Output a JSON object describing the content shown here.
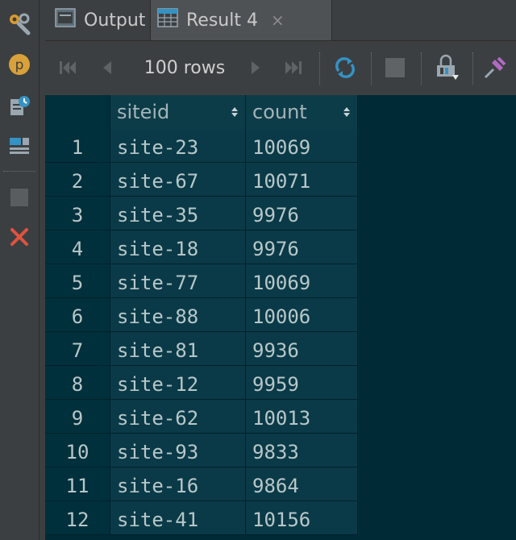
{
  "tabs": [
    {
      "label": "Output",
      "icon": "output-console-icon"
    },
    {
      "label": "Result 4",
      "icon": "table-icon",
      "active": true
    }
  ],
  "tab_close_glyph": "×",
  "toolbar": {
    "rows_label": "100 rows"
  },
  "left_strip": {
    "icons": [
      "settings-wrench-icon",
      "p-parameter-icon",
      "history-icon",
      "layout-icon",
      "stop-icon",
      "close-icon"
    ]
  },
  "grid": {
    "columns": [
      "siteid",
      "count"
    ],
    "rows": [
      {
        "n": "1",
        "siteid": "site-23",
        "count": "10069"
      },
      {
        "n": "2",
        "siteid": "site-67",
        "count": "10071"
      },
      {
        "n": "3",
        "siteid": "site-35",
        "count": "9976"
      },
      {
        "n": "4",
        "siteid": "site-18",
        "count": "9976"
      },
      {
        "n": "5",
        "siteid": "site-77",
        "count": "10069"
      },
      {
        "n": "6",
        "siteid": "site-88",
        "count": "10006"
      },
      {
        "n": "7",
        "siteid": "site-81",
        "count": "9936"
      },
      {
        "n": "8",
        "siteid": "site-12",
        "count": "9959"
      },
      {
        "n": "9",
        "siteid": "site-62",
        "count": "10013"
      },
      {
        "n": "10",
        "siteid": "site-93",
        "count": "9833"
      },
      {
        "n": "11",
        "siteid": "site-16",
        "count": "9864"
      },
      {
        "n": "12",
        "siteid": "site-41",
        "count": "10156"
      }
    ]
  },
  "colors": {
    "grid_bg": "#002b36",
    "accent_blue": "#3592c4",
    "close_red": "#e0533f",
    "p_badge": "#d8a13a"
  }
}
